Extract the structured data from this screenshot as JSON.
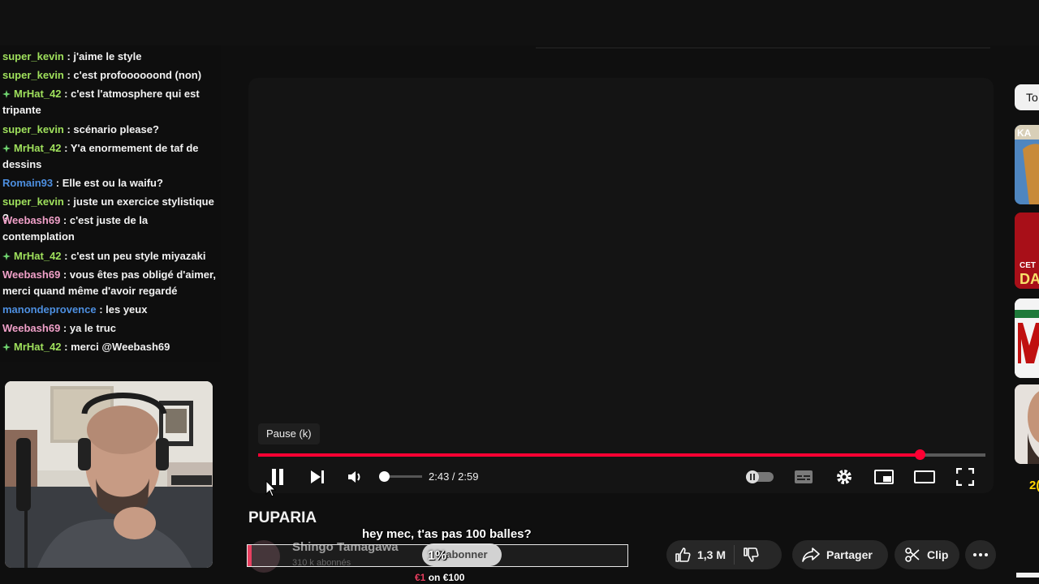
{
  "chat": {
    "messages": [
      {
        "user": "super_kevin",
        "user_color": "#9fe05c",
        "badge": false,
        "text": " : j'aime le style"
      },
      {
        "user": "super_kevin",
        "user_color": "#9fe05c",
        "badge": false,
        "text": " : c'est profoooooond (non)"
      },
      {
        "user": "MrHat_42",
        "user_color": "#9fe05c",
        "badge": true,
        "text": " : c'est l'atmosphere qui est tripante"
      },
      {
        "user": "super_kevin",
        "user_color": "#9fe05c",
        "badge": false,
        "text": " : scénario please?"
      },
      {
        "user": "MrHat_42",
        "user_color": "#9fe05c",
        "badge": true,
        "text": " : Y'a enormement de taf de dessins"
      },
      {
        "user": "Romain93",
        "user_color": "#4d8fe0",
        "badge": false,
        "text": " : Elle est ou la waifu?"
      },
      {
        "user": "super_kevin",
        "user_color": "#9fe05c",
        "badge": false,
        "text": " : juste un exercice stylistique ?"
      },
      {
        "user": "Weebash69",
        "user_color": "#f0a0c8",
        "badge": false,
        "text": " : c'est juste de la contemplation"
      },
      {
        "user": "MrHat_42",
        "user_color": "#9fe05c",
        "badge": true,
        "text": " : c'est un peu style miyazaki"
      },
      {
        "user": "Weebash69",
        "user_color": "#f0a0c8",
        "badge": false,
        "text": " : vous êtes pas obligé d'aimer, merci quand même d'avoir regardé"
      },
      {
        "user": "manondeprovence",
        "user_color": "#4d8fe0",
        "badge": false,
        "text": " : les yeux"
      },
      {
        "user": "Weebash69",
        "user_color": "#f0a0c8",
        "badge": false,
        "text": " : ya le truc"
      },
      {
        "user": "MrHat_42",
        "user_color": "#9fe05c",
        "badge": true,
        "text": " : merci @Weebash69"
      }
    ]
  },
  "player": {
    "tooltip": "Pause (k)",
    "time": "2:43 / 2:59",
    "progress_fraction": 0.91,
    "volume_fraction": 0.1,
    "accent_color": "#ff0033"
  },
  "video": {
    "title": "PUPARIA",
    "channel": "Shingo Tamagawa",
    "subscribers": "310 k abonnés",
    "subscribe_label": "S'abonner",
    "likes": "1,3 M",
    "share_label": "Partager",
    "clip_label": "Clip"
  },
  "donation": {
    "message": "hey mec, t'as pas 100 balles?",
    "percent": "1%",
    "current": "€1",
    "on": "on",
    "goal": "€100",
    "color": "#e84060"
  },
  "sidebar": {
    "chip_label": "To",
    "partial_text_1": "KA",
    "partial_text_2": "CET",
    "partial_text_3": "DA",
    "partial_number": "2("
  }
}
